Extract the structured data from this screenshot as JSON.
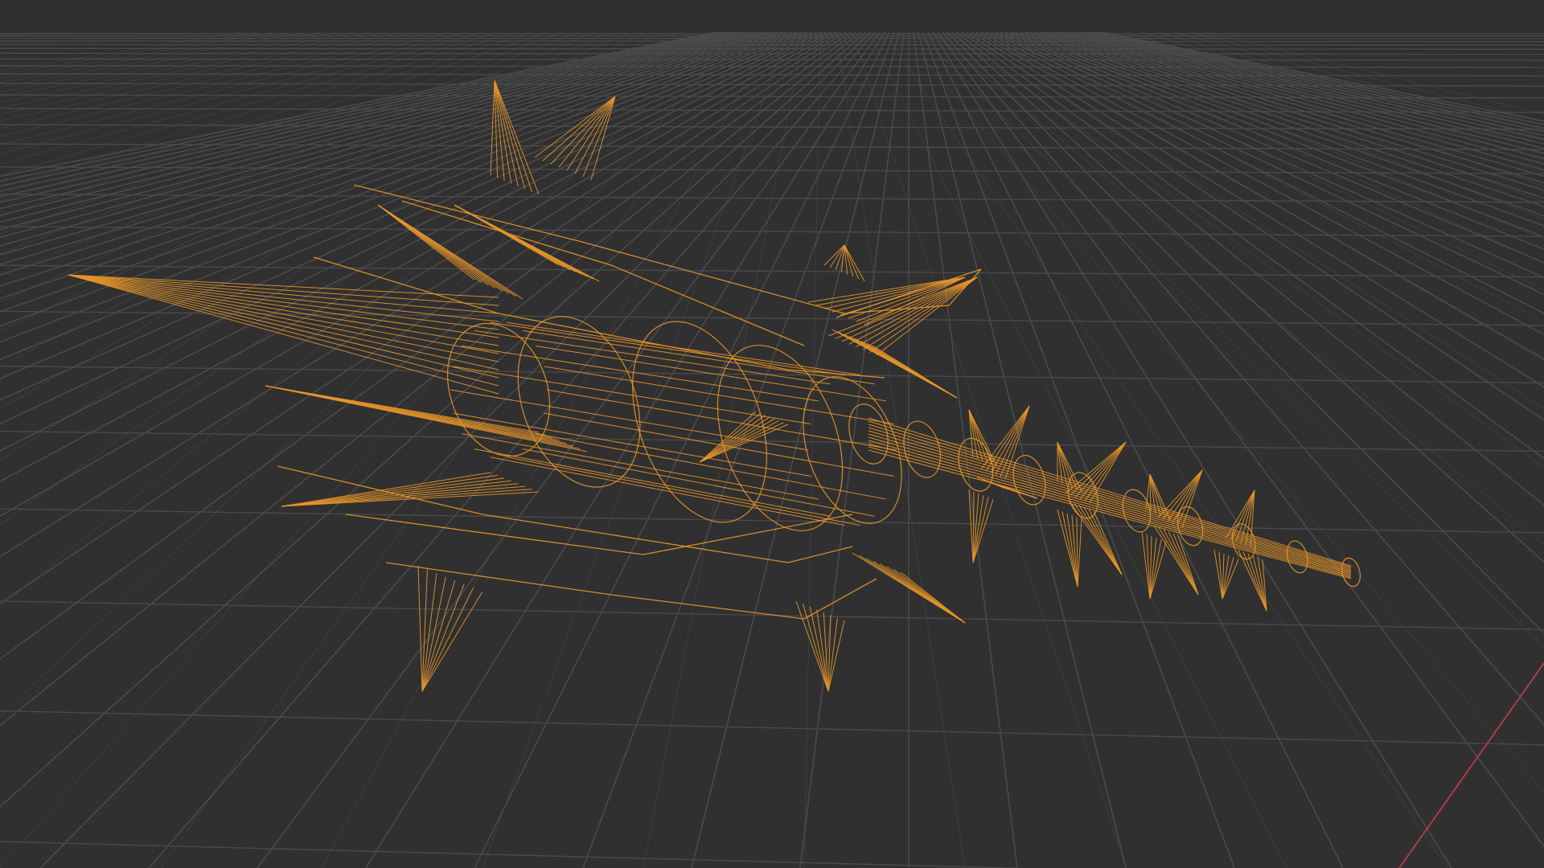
{
  "viewport": {
    "mode": "wireframe",
    "background_color": "#303030",
    "grid_color": "#4a4a4a",
    "grid_major_color": "#555555",
    "x_axis_color": "#b03a48",
    "wire_color": "#e8962a",
    "selected": true
  },
  "object": {
    "name_visible": false,
    "shape": "spiked mace"
  }
}
